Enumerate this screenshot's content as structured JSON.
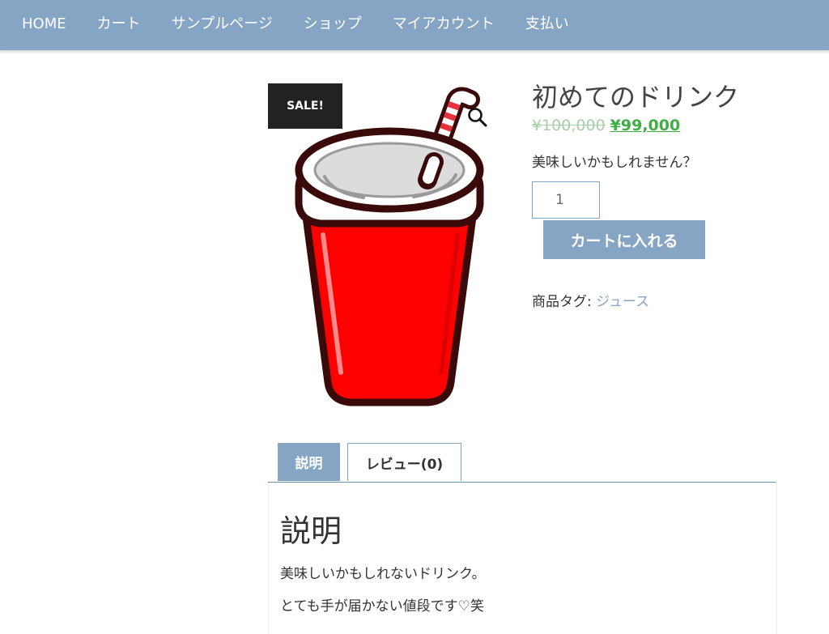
{
  "nav": {
    "items": [
      "HOME",
      "カート",
      "サンプルページ",
      "ショップ",
      "マイアカウント",
      "支払い"
    ]
  },
  "product": {
    "sale_badge": "SALE!",
    "title": "初めてのドリンク",
    "price_old": "¥100,000",
    "price_new": "¥99,000",
    "short_description": "美味しいかもしれません？",
    "quantity": "1",
    "add_to_cart_label": "カートに入れる",
    "tags_label": "商品タグ:",
    "tag": "ジュース"
  },
  "tabs": {
    "description_label": "説明",
    "reviews_label": "レビュー(0)"
  },
  "description": {
    "heading": "説明",
    "line1": "美味しいかもしれないドリンク。",
    "line2": "とても手が届かない値段です♡笑"
  },
  "colors": {
    "nav_bg": "#86a5c4",
    "price_sale": "#3fae46",
    "price_old": "#a7cfa8",
    "badge_bg": "#222222",
    "cup_red": "#ff0000"
  }
}
